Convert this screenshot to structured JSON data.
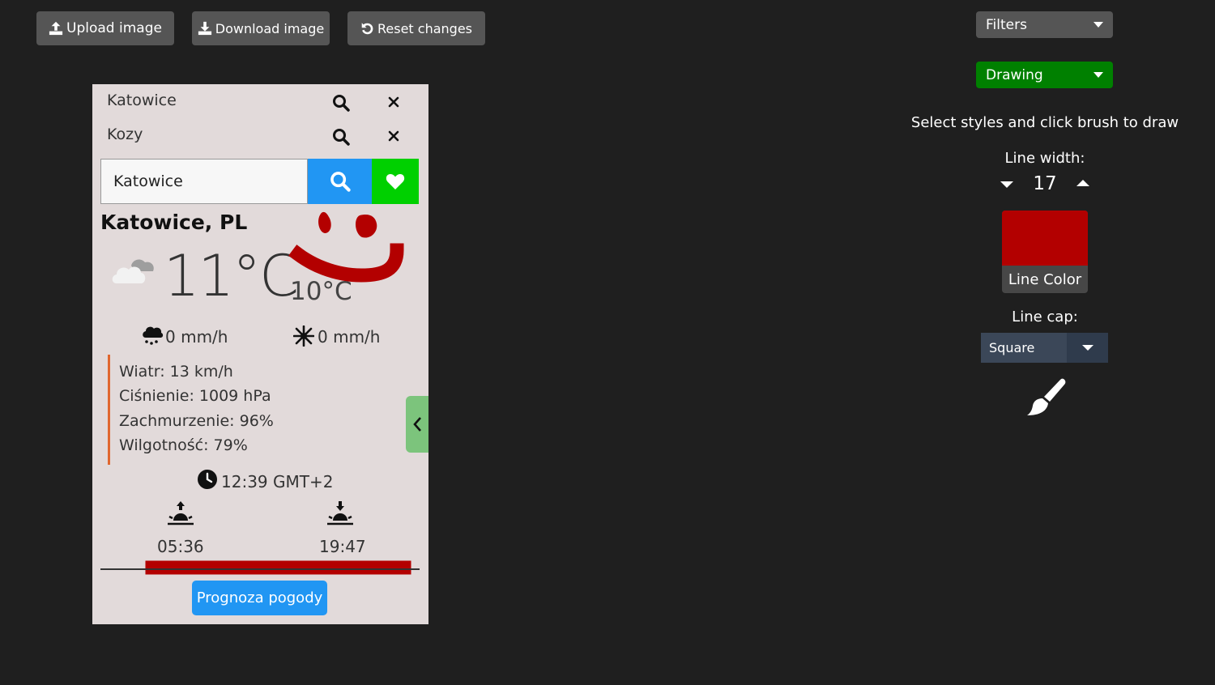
{
  "toolbar": {
    "upload_label": "Upload image",
    "download_label": "Download image",
    "reset_label": "Reset changes"
  },
  "panel": {
    "filters_label": "Filters",
    "drawing_label": "Drawing",
    "instructions": "Select styles and click brush to draw",
    "line_width_label": "Line width:",
    "line_width_value": "17",
    "line_color_label": "Line Color",
    "line_color": "#b30000",
    "line_cap_label": "Line cap:",
    "line_cap_value": "Square",
    "accent_green": "#008000"
  },
  "image": {
    "saved_locations": [
      {
        "name": "Katowice"
      },
      {
        "name": "Kozy"
      }
    ],
    "search_value": "Katowice",
    "city": "Katowice, PL",
    "temperature": "11°C",
    "feels_like": "10°C",
    "rain": "0 mm/h",
    "snow": "0 mm/h",
    "details": {
      "wind": "Wiatr: 13 km/h",
      "pressure": "Ciśnienie: 1009 hPa",
      "clouds": "Zachmurzenie: 96%",
      "humidity": "Wilgotność: 79%"
    },
    "time": "12:39 GMT+2",
    "sunrise": "05:36",
    "sunset": "19:47",
    "forecast_button": "Prognoza pogody",
    "icons": [
      "search-icon",
      "close-icon",
      "heart-icon",
      "cloud-icon",
      "rain-icon",
      "snowflake-icon",
      "clock-icon",
      "sunrise-icon",
      "sunset-icon",
      "chevron-left-icon"
    ]
  }
}
